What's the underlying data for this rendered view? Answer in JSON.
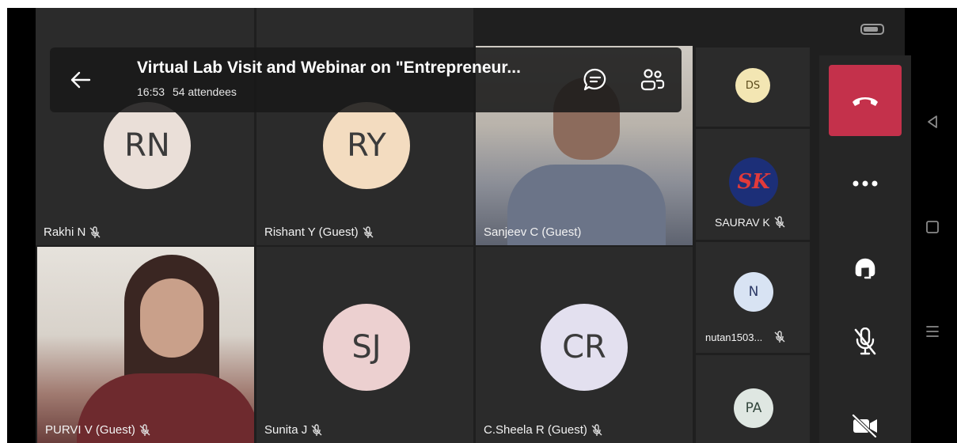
{
  "meeting": {
    "title": "Virtual Lab Visit and Webinar on \"Entrepreneur...",
    "time": "16:53",
    "attendees": "54 attendees"
  },
  "tiles": {
    "rakhi": {
      "initials": "RN",
      "name": "Rakhi N",
      "avatar_color": "#eadfd8"
    },
    "rishant": {
      "initials": "RY",
      "name": "Rishant Y (Guest)",
      "avatar_color": "#f3dcc0"
    },
    "sanjeev": {
      "name": "Sanjeev C (Guest)"
    },
    "purvi": {
      "name": "PURVI V (Guest)"
    },
    "sunita": {
      "initials": "SJ",
      "name": "Sunita J",
      "avatar_color": "#ecd0d0"
    },
    "sheela": {
      "initials": "CR",
      "name": "C.Sheela R (Guest)",
      "avatar_color": "#e3e0ef"
    }
  },
  "side_tiles": {
    "ds": {
      "initials": "DS",
      "avatar_color": "#f3e6b3"
    },
    "saurav": {
      "logo_text": "SK",
      "name": "SAURAV K"
    },
    "nutan": {
      "initials": "N",
      "name": "nutan1503...",
      "avatar_color": "#d8e3f3"
    },
    "pa": {
      "initials": "PA",
      "avatar_color": "#dfe7e2"
    }
  },
  "colors": {
    "app_bg": "#1f1f1f",
    "tile_bg": "#2b2b2b",
    "leave_red": "#c4314b"
  },
  "icons": [
    "back-arrow-icon",
    "chat-icon",
    "people-icon",
    "hang-up-icon",
    "more-icon",
    "headset-icon",
    "mic-off-icon",
    "video-off-icon",
    "nav-back-icon",
    "nav-home-icon",
    "nav-menu-icon"
  ]
}
